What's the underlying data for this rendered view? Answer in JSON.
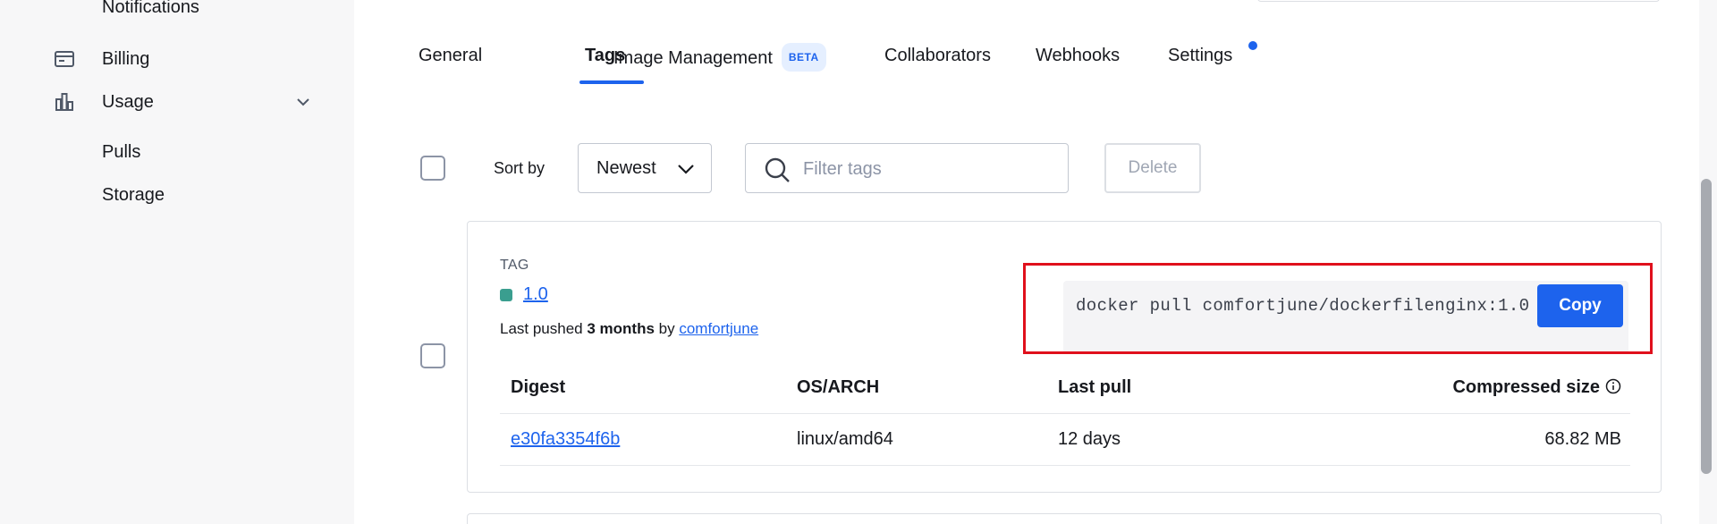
{
  "sidebar": {
    "items": [
      {
        "label": "Notifications"
      },
      {
        "label": "Billing",
        "icon": "credit-card-icon"
      },
      {
        "label": "Usage",
        "icon": "bar-chart-icon"
      },
      {
        "label": "Pulls"
      },
      {
        "label": "Storage"
      }
    ]
  },
  "tabs": [
    {
      "label": "General"
    },
    {
      "label": "Tags",
      "active": true
    },
    {
      "label": "Image Management",
      "badge": "BETA"
    },
    {
      "label": "Collaborators"
    },
    {
      "label": "Webhooks"
    },
    {
      "label": "Settings",
      "notification_dot": true
    }
  ],
  "toolbar": {
    "sort_label": "Sort by",
    "sort_value": "Newest",
    "filter_placeholder": "Filter tags",
    "delete_label": "Delete"
  },
  "tag_card": {
    "header": "TAG",
    "tag_name": "1.0",
    "pushed_prefix": "Last pushed ",
    "pushed_time": "3 months",
    "pushed_by": " by ",
    "pushed_user": "comfortjune",
    "command": "docker pull comfortjune/dockerfilenginx:1.0",
    "copy_label": "Copy",
    "table": {
      "columns": [
        "Digest",
        "OS/ARCH",
        "Last pull",
        "Compressed size"
      ],
      "rows": [
        {
          "digest": "e30fa3354f6b",
          "os_arch": "linux/amd64",
          "last_pull": "12 days",
          "size": "68.82 MB"
        }
      ]
    }
  },
  "colors": {
    "accent": "#1d63ed",
    "highlight": "#e0101c",
    "tag_status": "#3a9e8f"
  }
}
